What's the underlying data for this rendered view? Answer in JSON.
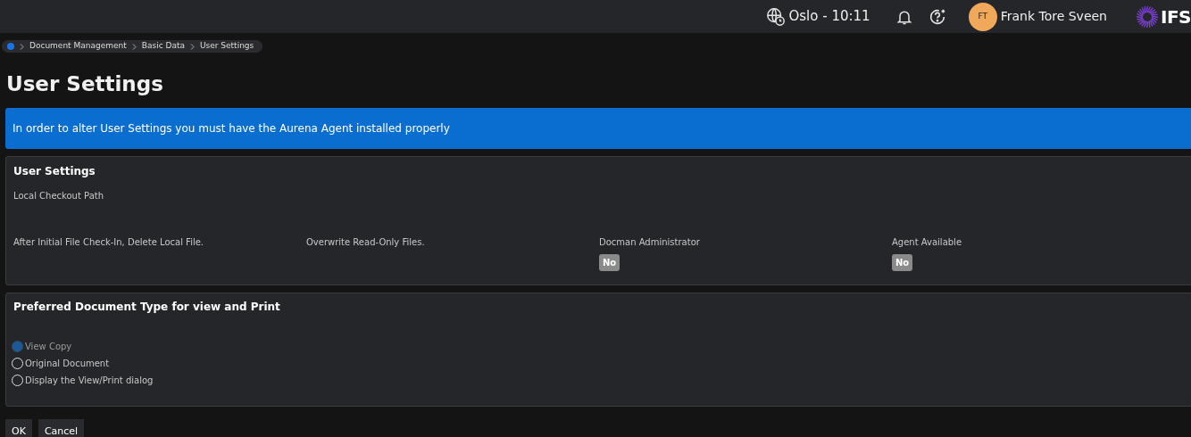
{
  "header": {
    "location_time": "Oslo - 10:11",
    "user_initials": "FT",
    "user_name": "Frank Tore Sveen",
    "logo_text": "IFS"
  },
  "breadcrumb": [
    "Document Management",
    "Basic Data",
    "User Settings"
  ],
  "page_title": "User Settings",
  "banner": "In order to alter User Settings you must have the Aurena Agent installed properly",
  "settings_group": {
    "title": "User Settings",
    "path_label": "Local Checkout Path",
    "fields": [
      {
        "label": "After Initial File Check-In, Delete Local File."
      },
      {
        "label": "Overwrite Read-Only Files."
      },
      {
        "label": "Docman Administrator",
        "value": "No"
      },
      {
        "label": "Agent Available",
        "value": "No"
      }
    ]
  },
  "document_type_group": {
    "title": "Preferred Document Type for view and Print",
    "options": [
      {
        "label": "View Copy",
        "selected": true
      },
      {
        "label": "Original Document",
        "selected": false
      },
      {
        "label": "Display the View/Print dialog",
        "selected": false
      }
    ]
  },
  "buttons": [
    "OK",
    "Cancel"
  ]
}
